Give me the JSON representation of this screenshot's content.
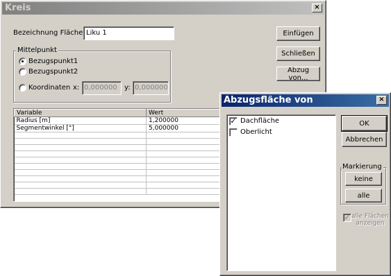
{
  "kreis_window": {
    "title": "Kreis",
    "close_glyph": "×",
    "bezeichnung_label": "Bezeichnung Fläche:",
    "bezeichnung_value": "Liku 1",
    "mittelpunkt_group": "Mittelpunkt",
    "radio_bezugspunkt1": "Bezugspunkt1",
    "radio_bezugspunkt2": "Bezugspunkt2",
    "radio_koordinaten": "Koordinaten",
    "selected_radio": "Bezugspunkt1",
    "x_label": "x:",
    "x_value": "0,000000",
    "y_label": "y:",
    "y_value": "0,000000",
    "buttons": {
      "einfuegen": "Einfügen",
      "schliessen": "Schließen",
      "abzug_von": "Abzug von..."
    },
    "table": {
      "headers": [
        "Variable",
        "Wert"
      ],
      "rows": [
        [
          "Radius [m]",
          "1,200000"
        ],
        [
          "Segmentwinkel [°]",
          "5,000000"
        ]
      ]
    }
  },
  "abzug_dialog": {
    "title": "Abzugsfläche von",
    "close_glyph": "×",
    "items": [
      {
        "label": "Dachfläche",
        "checked": true
      },
      {
        "label": "Oberlicht",
        "checked": false
      }
    ],
    "buttons": {
      "ok": "OK",
      "abbrechen": "Abbrechen",
      "keine": "keine",
      "alle": "alle"
    },
    "markierung_group": "Markierung",
    "alle_flaechen_label": "alle Flächen anzeigen",
    "alle_flaechen_checked": true,
    "alle_flaechen_disabled": true
  },
  "colors": {
    "kreis_title_bar": "#a0a0a0",
    "abzug_title_bar": "#0a246a",
    "face": "#d4d0c8"
  }
}
